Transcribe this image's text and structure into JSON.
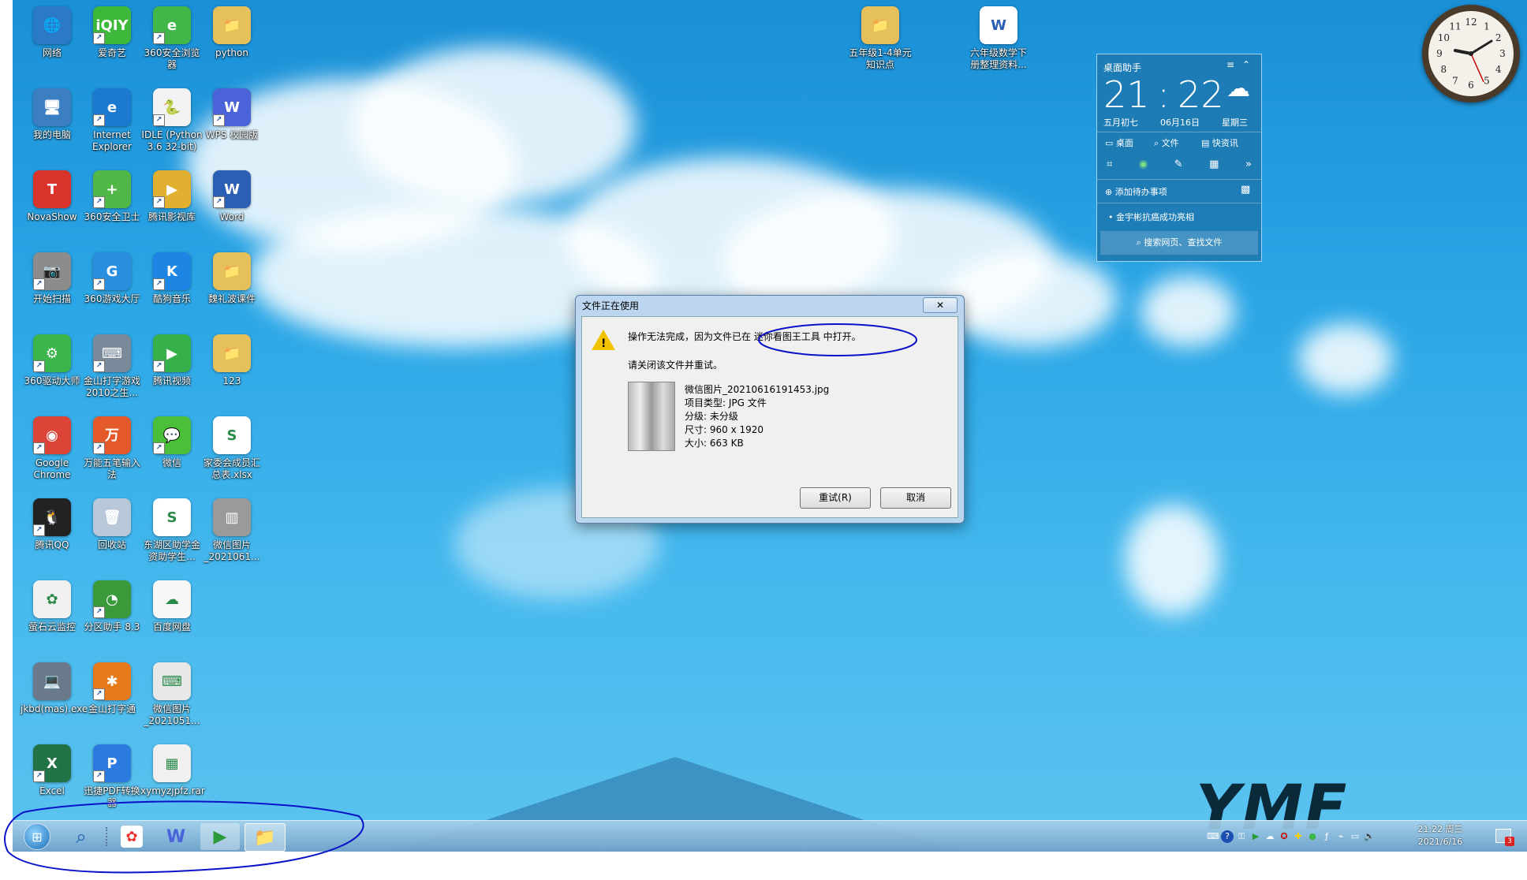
{
  "desktop_icons": [
    {
      "label": "网络",
      "color": "#2a7ac8",
      "glyph": "🌐",
      "icon": "network-icon",
      "shortcut": false
    },
    {
      "label": "爱奇艺",
      "color": "#3db83a",
      "glyph": "iQIY",
      "icon": "iqiyi-icon",
      "shortcut": true
    },
    {
      "label": "360安全浏览器",
      "color": "#43b649",
      "glyph": "e",
      "icon": "360-browser-icon",
      "shortcut": true
    },
    {
      "label": "python",
      "color": "#e6c05a",
      "glyph": "📁",
      "icon": "folder-icon",
      "shortcut": false
    },
    {
      "label": "我的电脑",
      "color": "#3b7ec2",
      "glyph": "🖥",
      "icon": "computer-icon",
      "shortcut": false
    },
    {
      "label": "Internet Explorer",
      "color": "#1b79d2",
      "glyph": "e",
      "icon": "ie-icon",
      "shortcut": true
    },
    {
      "label": "IDLE (Python 3.6 32-bit)",
      "color": "#f2f2f2",
      "glyph": "🐍",
      "icon": "python-idle-icon",
      "shortcut": true
    },
    {
      "label": "WPS 校园版",
      "color": "#4a63d8",
      "glyph": "W",
      "icon": "wps-icon",
      "shortcut": true
    },
    {
      "label": "NovaShow",
      "color": "#d9332b",
      "glyph": "T",
      "icon": "novashow-icon",
      "shortcut": false
    },
    {
      "label": "360安全卫士",
      "color": "#51b848",
      "glyph": "+",
      "icon": "360-safe-icon",
      "shortcut": true
    },
    {
      "label": "腾讯影视库",
      "color": "#e2b030",
      "glyph": "▶",
      "icon": "tencent-film-icon",
      "shortcut": true
    },
    {
      "label": "Word",
      "color": "#2b5fb4",
      "glyph": "W",
      "icon": "word-icon",
      "shortcut": true
    },
    {
      "label": "开始扫描",
      "color": "#8c8c8c",
      "glyph": "📷",
      "icon": "scanner-icon",
      "shortcut": true
    },
    {
      "label": "360游戏大厅",
      "color": "#2a8ee0",
      "glyph": "G",
      "icon": "360-game-icon",
      "shortcut": true
    },
    {
      "label": "酷狗音乐",
      "color": "#1d86e4",
      "glyph": "K",
      "icon": "kugou-icon",
      "shortcut": true
    },
    {
      "label": "魏礼波课件",
      "color": "#e6c05a",
      "glyph": "📁",
      "icon": "folder-icon",
      "shortcut": false
    },
    {
      "label": "360驱动大师",
      "color": "#3cb54a",
      "glyph": "⚙",
      "icon": "360-driver-icon",
      "shortcut": true
    },
    {
      "label": "金山打字游戏2010之生...",
      "color": "#7a8a9a",
      "glyph": "⌨",
      "icon": "typing-game-icon",
      "shortcut": true
    },
    {
      "label": "腾讯视频",
      "color": "#36b04a",
      "glyph": "▶",
      "icon": "tencent-video-icon",
      "shortcut": true
    },
    {
      "label": "123",
      "color": "#e6c05a",
      "glyph": "📁",
      "icon": "folder-icon",
      "shortcut": false
    },
    {
      "label": "Google Chrome",
      "color": "#db4437",
      "glyph": "◉",
      "icon": "chrome-icon",
      "shortcut": true
    },
    {
      "label": "万能五笔输入法",
      "color": "#e45a2a",
      "glyph": "万",
      "icon": "wubi-icon",
      "shortcut": true
    },
    {
      "label": "微信",
      "color": "#4cbf3a",
      "glyph": "💬",
      "icon": "wechat-icon",
      "shortcut": true
    },
    {
      "label": "家委会成员汇总表.xlsx",
      "color": "#ffffff",
      "glyph": "S",
      "icon": "xlsx-file-icon",
      "shortcut": false
    },
    {
      "label": "腾讯QQ",
      "color": "#222222",
      "glyph": "🐧",
      "icon": "qq-icon",
      "shortcut": true
    },
    {
      "label": "回收站",
      "color": "#b8c8d8",
      "glyph": "🗑",
      "icon": "recycle-bin-icon",
      "shortcut": false
    },
    {
      "label": "东湖区助学金资助学生...",
      "color": "#ffffff",
      "glyph": "S",
      "icon": "xlsx-file-icon",
      "shortcut": false
    },
    {
      "label": "微信图片_2021061...",
      "color": "#9a9a9a",
      "glyph": "▥",
      "icon": "image-file-icon",
      "shortcut": false
    },
    {
      "label": "萤石云监控",
      "color": "#f0f0f0",
      "glyph": "✿",
      "icon": "ezviz-icon",
      "shortcut": false
    },
    {
      "label": "分区助手 8.3",
      "color": "#3a9a3a",
      "glyph": "◔",
      "icon": "partition-icon",
      "shortcut": true
    },
    {
      "label": "百度网盘",
      "color": "#f7f7f7",
      "glyph": "☁",
      "icon": "baidu-netdisk-icon",
      "shortcut": false
    },
    {
      "label": "",
      "color": "transparent",
      "glyph": "",
      "icon": "empty-slot",
      "shortcut": false
    },
    {
      "label": "jkbd(mas).exe",
      "color": "#6a7a8a",
      "glyph": "💻",
      "icon": "exe-icon",
      "shortcut": false
    },
    {
      "label": "金山打字通",
      "color": "#e67a1a",
      "glyph": "✱",
      "icon": "typing-icon",
      "shortcut": true
    },
    {
      "label": "微信图片_2021051...",
      "color": "#e8e8e8",
      "glyph": "⌨",
      "icon": "image-file-icon",
      "shortcut": false
    },
    {
      "label": "",
      "color": "transparent",
      "glyph": "",
      "icon": "empty-slot",
      "shortcut": false
    },
    {
      "label": "Excel",
      "color": "#217346",
      "glyph": "X",
      "icon": "excel-icon",
      "shortcut": true
    },
    {
      "label": "迅捷PDF转换器",
      "color": "#2b7ae0",
      "glyph": "P",
      "icon": "pdf-converter-icon",
      "shortcut": true
    },
    {
      "label": "xymyzjpfz.rar",
      "color": "#f0f0f0",
      "glyph": "▦",
      "icon": "rar-file-icon",
      "shortcut": false
    }
  ],
  "top_files": [
    {
      "label": "五年级1-4单元知识点",
      "icon": "folder-icon",
      "color": "#e6c05a",
      "glyph": "📁"
    },
    {
      "label": "六年级数学下册整理资料...",
      "icon": "word-doc-icon",
      "color": "#ffffff",
      "glyph": "W"
    }
  ],
  "gadget": {
    "title": "桌面助手",
    "hour": "21",
    "minute": "22",
    "lunar": "五月初七",
    "date": "06月16日",
    "weekday": "星期三",
    "tabs": [
      "桌面",
      "文件",
      "快资讯"
    ],
    "todo": "添加待办事项",
    "news": "金宇彬抗癌成功亮相",
    "search": "搜索网页、查找文件"
  },
  "clock": {
    "numbers": [
      "12",
      "1",
      "2",
      "3",
      "4",
      "5",
      "6",
      "7",
      "8",
      "9",
      "10",
      "11"
    ]
  },
  "dialog": {
    "title": "文件正在使用",
    "close": "✕",
    "message": "操作无法完成，因为文件已在 迷你看图王工具 中打开。",
    "instruction": "请关闭该文件并重试。",
    "file_name": "微信图片_20210616191453.jpg",
    "file_type": "项目类型: JPG 文件",
    "rating": "分级: 未分级",
    "dimensions": "尺寸: 960 x 1920",
    "size": "大小: 663 KB",
    "retry": "重试(R)",
    "cancel": "取消"
  },
  "taskbar": {
    "time": "21:22 周三",
    "date": "2021/6/16",
    "notification_badge": "3"
  },
  "watermark": "YMF"
}
